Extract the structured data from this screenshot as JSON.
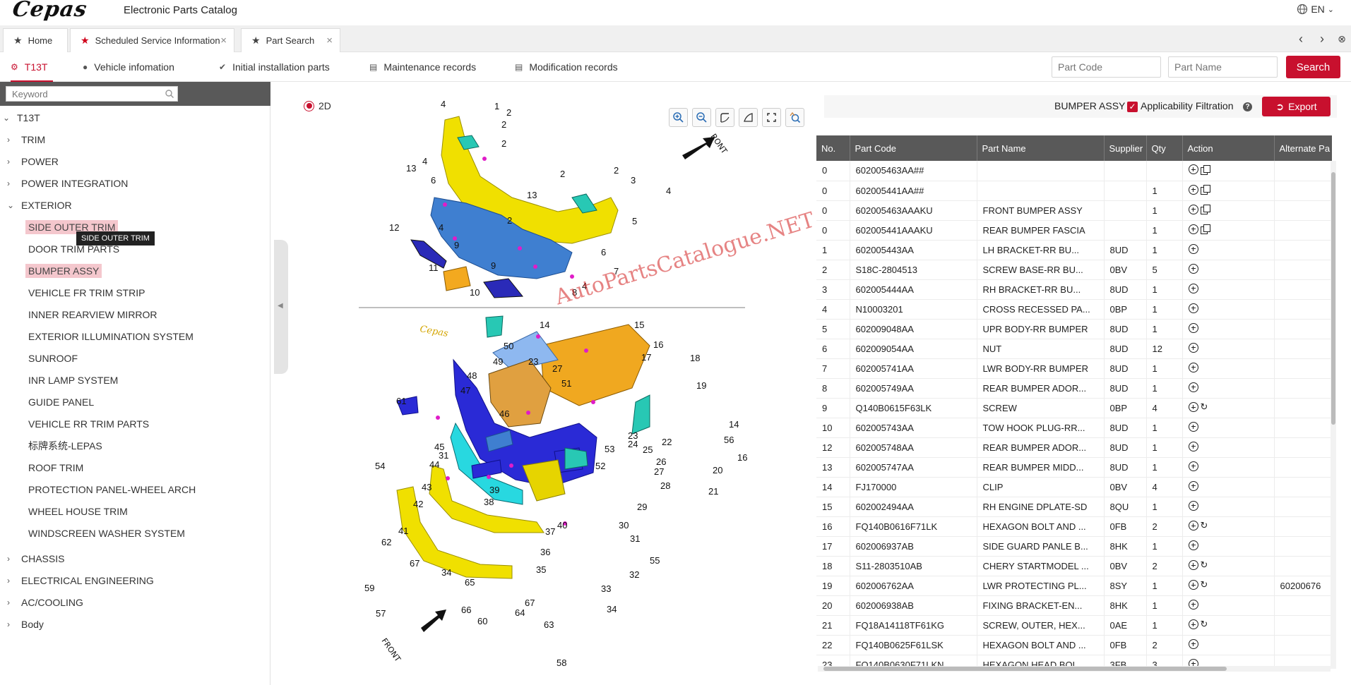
{
  "app": {
    "logo": "Cepas",
    "title": "Electronic Parts Catalog",
    "language": "EN"
  },
  "tabs": [
    {
      "label": "Home",
      "closable": false
    },
    {
      "label": "Scheduled Service Information",
      "closable": true
    },
    {
      "label": "Part Search",
      "closable": true
    }
  ],
  "vehicle_nav": {
    "items": [
      "T13T",
      "Vehicle infomation",
      "Initial installation parts",
      "Maintenance records",
      "Modification records"
    ],
    "part_code_placeholder": "Part Code",
    "part_name_placeholder": "Part Name",
    "search_label": "Search"
  },
  "tree": {
    "keyword_placeholder": "Keyword",
    "root": "T13T",
    "groups": [
      "TRIM",
      "POWER",
      "POWER INTEGRATION",
      "EXTERIOR"
    ],
    "exterior_children": [
      "SIDE OUTER TRIM",
      "DOOR TRIM PARTS",
      "BUMPER ASSY",
      "VEHICLE FR TRIM STRIP",
      "INNER REARVIEW MIRROR",
      "EXTERIOR ILLUMINATION SYSTEM",
      "SUNROOF",
      "INR LAMP SYSTEM",
      "GUIDE PANEL",
      "VEHICLE RR TRIM PARTS",
      "标牌系统-LEPAS",
      "ROOF TRIM",
      "PROTECTION PANEL-WHEEL ARCH",
      "WHEEL HOUSE TRIM",
      "WINDSCREEN WASHER SYSTEM"
    ],
    "groups_after": [
      "CHASSIS",
      "ELECTRICAL ENGINEERING",
      "AC/COOLING",
      "Body"
    ],
    "tooltip": "SIDE OUTER TRIM"
  },
  "diagram": {
    "view_mode": "2D",
    "watermark": "AutoPartsCatalogue.NET",
    "front_label": "FRONT",
    "upper_callouts": [
      "4",
      "1",
      "2",
      "2",
      "2",
      "13",
      "4",
      "6",
      "2",
      "2",
      "3",
      "4",
      "13",
      "5",
      "12",
      "4",
      "9",
      "2",
      "6",
      "11",
      "9",
      "7",
      "10",
      "4",
      "8"
    ],
    "lower_callouts": [
      "14",
      "15",
      "16",
      "50",
      "17",
      "18",
      "49",
      "23",
      "27",
      "48",
      "51",
      "19",
      "47",
      "61",
      "46",
      "14",
      "23",
      "56",
      "45",
      "24",
      "22",
      "16",
      "31",
      "53",
      "25",
      "54",
      "44",
      "52",
      "26",
      "20",
      "27",
      "43",
      "39",
      "28",
      "21",
      "42",
      "38",
      "29",
      "40",
      "41",
      "30",
      "37",
      "31",
      "62",
      "36",
      "55",
      "67",
      "35",
      "34",
      "65",
      "32",
      "59",
      "33",
      "67",
      "66",
      "64",
      "34",
      "57",
      "60",
      "63",
      "58"
    ],
    "tools": [
      "zoom-in",
      "zoom-out",
      "rotate-left",
      "rotate-right",
      "fullscreen",
      "locate"
    ]
  },
  "parts": {
    "assembly_title": "BUMPER ASSY",
    "applicability_label": "Applicability Filtration",
    "applicability_checked": true,
    "export_label": "Export",
    "columns": [
      "No.",
      "Part Code",
      "Part Name",
      "Supplier",
      "Qty",
      "Action",
      "Alternate Pa"
    ],
    "rows": [
      {
        "no": "0",
        "code": "602005463AA##",
        "name": "",
        "supplier": "",
        "qty": "",
        "copy": true,
        "swap": false,
        "alt": ""
      },
      {
        "no": "0",
        "code": "602005441AA##",
        "name": "",
        "supplier": "",
        "qty": "1",
        "copy": true,
        "swap": false,
        "alt": ""
      },
      {
        "no": "0",
        "code": "602005463AAAKU",
        "name": "FRONT BUMPER ASSY",
        "supplier": "",
        "qty": "1",
        "copy": true,
        "swap": false,
        "alt": ""
      },
      {
        "no": "0",
        "code": "602005441AAAKU",
        "name": "REAR BUMPER FASCIA",
        "supplier": "",
        "qty": "1",
        "copy": true,
        "swap": false,
        "alt": ""
      },
      {
        "no": "1",
        "code": "602005443AA",
        "name": "LH BRACKET-RR BU...",
        "supplier": "8UD",
        "qty": "1",
        "copy": false,
        "swap": false,
        "alt": ""
      },
      {
        "no": "2",
        "code": "S18C-2804513",
        "name": "SCREW BASE-RR BU...",
        "supplier": "0BV",
        "qty": "5",
        "copy": false,
        "swap": false,
        "alt": ""
      },
      {
        "no": "3",
        "code": "602005444AA",
        "name": "RH BRACKET-RR BU...",
        "supplier": "8UD",
        "qty": "1",
        "copy": false,
        "swap": false,
        "alt": ""
      },
      {
        "no": "4",
        "code": "N10003201",
        "name": "CROSS RECESSED PA...",
        "supplier": "0BP",
        "qty": "1",
        "copy": false,
        "swap": false,
        "alt": ""
      },
      {
        "no": "5",
        "code": "602009048AA",
        "name": "UPR BODY-RR BUMPER",
        "supplier": "8UD",
        "qty": "1",
        "copy": false,
        "swap": false,
        "alt": ""
      },
      {
        "no": "6",
        "code": "602009054AA",
        "name": "NUT",
        "supplier": "8UD",
        "qty": "12",
        "copy": false,
        "swap": false,
        "alt": ""
      },
      {
        "no": "7",
        "code": "602005741AA",
        "name": "LWR BODY-RR BUMPER",
        "supplier": "8UD",
        "qty": "1",
        "copy": false,
        "swap": false,
        "alt": ""
      },
      {
        "no": "8",
        "code": "602005749AA",
        "name": "REAR BUMPER ADOR...",
        "supplier": "8UD",
        "qty": "1",
        "copy": false,
        "swap": false,
        "alt": ""
      },
      {
        "no": "9",
        "code": "Q140B0615F63LK",
        "name": "SCREW",
        "supplier": "0BP",
        "qty": "4",
        "copy": false,
        "swap": true,
        "alt": ""
      },
      {
        "no": "10",
        "code": "602005743AA",
        "name": "TOW HOOK PLUG-RR...",
        "supplier": "8UD",
        "qty": "1",
        "copy": false,
        "swap": false,
        "alt": ""
      },
      {
        "no": "12",
        "code": "602005748AA",
        "name": "REAR BUMPER ADOR...",
        "supplier": "8UD",
        "qty": "1",
        "copy": false,
        "swap": false,
        "alt": ""
      },
      {
        "no": "13",
        "code": "602005747AA",
        "name": "REAR BUMPER MIDD...",
        "supplier": "8UD",
        "qty": "1",
        "copy": false,
        "swap": false,
        "alt": ""
      },
      {
        "no": "14",
        "code": "FJ170000",
        "name": "CLIP",
        "supplier": "0BV",
        "qty": "4",
        "copy": false,
        "swap": false,
        "alt": ""
      },
      {
        "no": "15",
        "code": "602002494AA",
        "name": "RH ENGINE DPLATE-SD",
        "supplier": "8QU",
        "qty": "1",
        "copy": false,
        "swap": false,
        "alt": ""
      },
      {
        "no": "16",
        "code": "FQ140B0616F71LK",
        "name": "HEXAGON BOLT AND ...",
        "supplier": "0FB",
        "qty": "2",
        "copy": false,
        "swap": true,
        "alt": ""
      },
      {
        "no": "17",
        "code": "602006937AB",
        "name": "SIDE GUARD PANLE B...",
        "supplier": "8HK",
        "qty": "1",
        "copy": false,
        "swap": false,
        "alt": ""
      },
      {
        "no": "18",
        "code": "S11-2803510AB",
        "name": "CHERY STARTMODEL ...",
        "supplier": "0BV",
        "qty": "2",
        "copy": false,
        "swap": true,
        "alt": ""
      },
      {
        "no": "19",
        "code": "602006762AA",
        "name": "LWR PROTECTING PL...",
        "supplier": "8SY",
        "qty": "1",
        "copy": false,
        "swap": true,
        "alt": "60200676"
      },
      {
        "no": "20",
        "code": "602006938AB",
        "name": "FIXING BRACKET-EN...",
        "supplier": "8HK",
        "qty": "1",
        "copy": false,
        "swap": false,
        "alt": ""
      },
      {
        "no": "21",
        "code": "FQ18A14118TF61KG",
        "name": "SCREW, OUTER, HEX...",
        "supplier": "0AE",
        "qty": "1",
        "copy": false,
        "swap": true,
        "alt": ""
      },
      {
        "no": "22",
        "code": "FQ140B0625F61LSK",
        "name": "HEXAGON BOLT AND ...",
        "supplier": "0FB",
        "qty": "2",
        "copy": false,
        "swap": false,
        "alt": ""
      },
      {
        "no": "23",
        "code": "FQ140B0630F71LKN",
        "name": "HEXAGON HEAD BOL...",
        "supplier": "3FB",
        "qty": "3",
        "copy": false,
        "swap": false,
        "alt": ""
      }
    ]
  }
}
